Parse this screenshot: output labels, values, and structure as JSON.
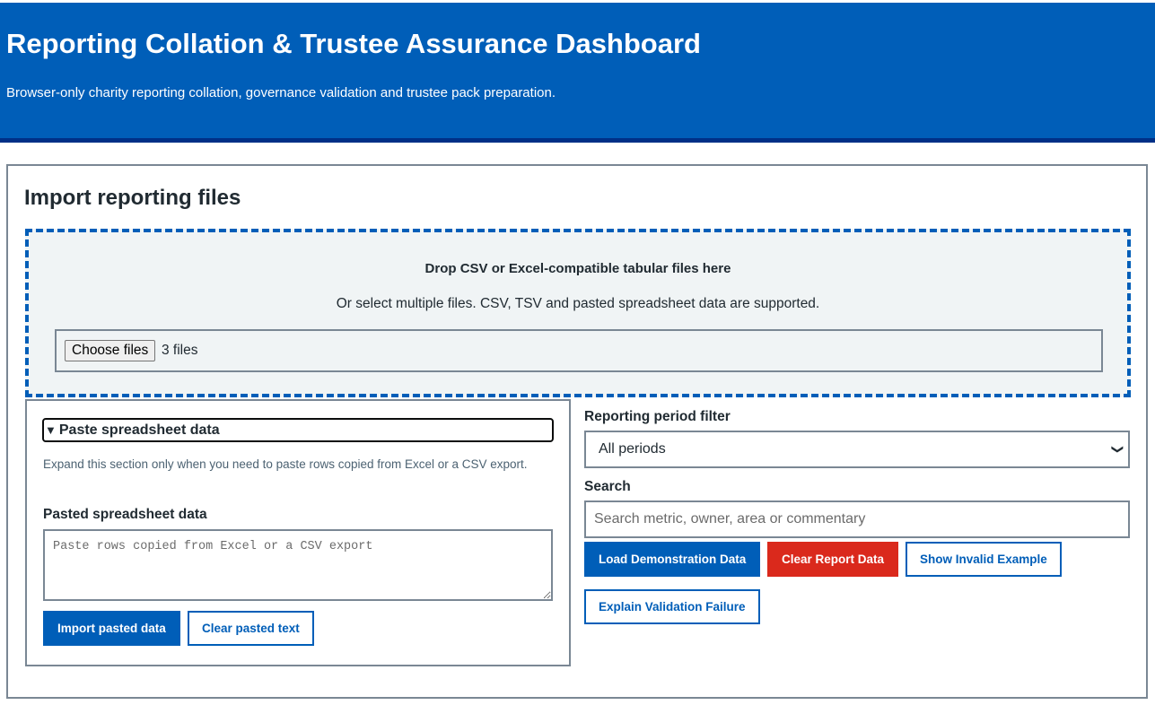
{
  "header": {
    "title": "Reporting Collation & Trustee Assurance Dashboard",
    "subtitle": "Browser-only charity reporting collation, governance validation and trustee pack preparation."
  },
  "import": {
    "heading": "Import reporting files",
    "drop_title": "Drop CSV or Excel-compatible tabular files here",
    "drop_desc": "Or select multiple files. CSV, TSV and pasted spreadsheet data are supported.",
    "choose_label": "Choose files",
    "file_count": "3 files"
  },
  "paste": {
    "summary_icon": "triangle-down-icon",
    "summary": "Paste spreadsheet data",
    "expand_text": "Expand this section only when you need to paste rows copied from Excel or a CSV export.",
    "label": "Pasted spreadsheet data",
    "placeholder": "Paste rows copied from Excel or a CSV export",
    "value": "",
    "import_button": "Import pasted data",
    "clear_button": "Clear pasted text"
  },
  "filters": {
    "period_label": "Reporting period filter",
    "period_selected": "All periods",
    "search_label": "Search",
    "search_placeholder": "Search metric, owner, area or commentary",
    "search_value": ""
  },
  "actions": {
    "load_demo": "Load Demonstration Data",
    "clear_report": "Clear Report Data",
    "show_invalid": "Show Invalid Example",
    "explain_failure": "Explain Validation Failure"
  },
  "colors": {
    "brand_blue": "#005eb8",
    "header_rule": "#003087",
    "danger_red": "#da291c",
    "border_grey": "#7a8794"
  }
}
